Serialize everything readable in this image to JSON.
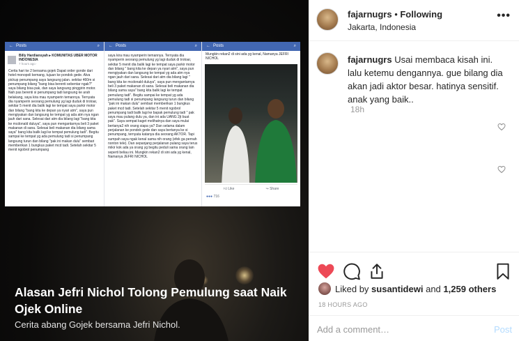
{
  "media": {
    "screenshot": {
      "bar_label": "Posts",
      "author_name": "Billy Hardiansyah ▸ KOMUNITAS UBER MOTOR INDONESIA",
      "author_time": "7 hours ago · ",
      "col1_text": "Cerita hari ke 2 bersama gojek\n\nDapat order gonde dari hotel monopoli kemang, tujuan ke pondok gede. Alva pickup penumpang saya langsung jalan. sekitar 460m si penumpang bilang \"bang bisa berenti sebentar ngak?\" saya bilang bisa pak, dan saya langsung pinggirin motor. Nah pas berenti si penumpang tadi langsung ke arah belakang, saya kira mau nyamperin temannya. Ternyata dia nyamperin seorang pemulung yg lagi duduk di trotoar, sekitar 5 menit dia balik lagi ke tempat saya parkir motor dan bilang \"bang kita ke depan ya nyari atm\", saya pun mengiyakan dan langsung ke tempat yg ada atm nya ngan jauh dari sana. Selesai dari atm dia bilang lagi \"bang kita ke mcdonald duluya\", saya pun mengantarnya beli 3 paket makanan di sana. Selesai beli makanan dia bilang sama saya\" bang kita balik lagi ke tempat pemulung tadi\". Begitu sampai ke tempat yg ada pemulung tadi si penumpang langsung turun dan bilang \"pak ini makan dulu\" sembari memberikan 1 bungkus paket mcd tadi. Setelah sekitar 5 menit ngobrol penumpang",
      "col2_text": "saya kira mau nyamperin temannya. Ternyata dia nyamperin seorang pemulung yg lagi duduk di trotoar, sekitar 5 menit dia balik lagi ke tempat saya parkir motor dan bilang \" bang kita ke depan ya nyari atm\", saya pun mengiyakan dan langsung ke tempat yg ada atm nya ngan jauh dari sana. Selesai dari atm dia bilang lagi \" bang kita ke mcdonald duluya\", saya pun mengantarnya beli 3 paket makanan di sana. Selesai beli makanan dia bilang sama saya\" bang kita balik lagi ke tempat pemulung tadi\". Begitu sampai ke tempat yg ada pemulung tadi si penumpang langsung turun dan bilang \"pak ini makan dulu\" sembari memberikan 1 bungkus paket mcd tadi. Setelah sekitar 5 menit ngobrol penumpang tadi balik lagi ke bapak pemulung tadi \" pak saya mau pulang dulu ya, dan ini ada UANG 2jt buat pak\". Saya sempat kaget melihatnya dan saya mulai bertanya2 nih orang siapa ya? Dan selama dalam perjalanan ke pondok gede dan saya bertanya ke si penumpang, ternyata katanya dia seorang AKTOR. Tapi sumpah saya ngak kenal sama nih orang (efek ga pernah nonton tele). Dan sepanjang perjalanan pulang saya terus mikir kok ada ya orang yg begitu peduli sama orang lain seperti beliau ini. Mungkin rekan2 di sini ada yg kenal, Namanya JEFRI NICHOL",
      "col3_text": "Mungkin rekan2 di sini ada yg kenal, Namanya JEFRI NICHOL",
      "like_label": "Like",
      "share_label": "Share",
      "reaction_count": "716"
    },
    "caption_title": "Alasan Jefri Nichol Tolong Pemulung saat Naik Ojek Online",
    "caption_subtitle": "Cerita abang Gojek bersama Jefri Nichol."
  },
  "header": {
    "username": "fajarnugrs",
    "separator": " • ",
    "follow_status": "Following",
    "location": "Jakarta, Indonesia",
    "more_label": "•••"
  },
  "comment": {
    "username": "fajarnugrs",
    "text": "Usai membaca kisah ini. lalu ketemu dengannya. gue bilang dia akan jadi aktor besar. hatinya sensitif. anak yang baik..",
    "time": "18h"
  },
  "likes": {
    "prefix": "Liked by ",
    "user": "susantidewi",
    "middle": " and ",
    "others": "1,259 others"
  },
  "timestamp": "18 HOURS AGO",
  "add_comment": {
    "placeholder": "Add a comment…",
    "post_label": "Post"
  },
  "colors": {
    "like_red": "#ed4956",
    "post_disabled": "#b3dbff",
    "fb_blue": "#4267b2"
  }
}
